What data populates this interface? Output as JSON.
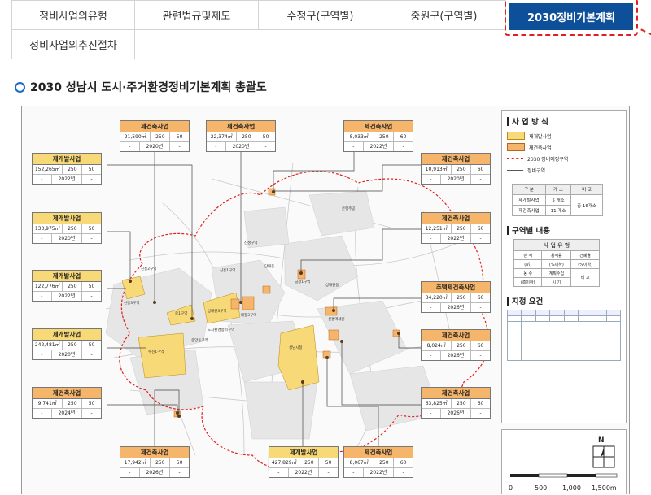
{
  "tabs": [
    {
      "label": "정비사업의유형",
      "active": false
    },
    {
      "label": "관련법규및제도",
      "active": false
    },
    {
      "label": "수정구(구역별)",
      "active": false
    },
    {
      "label": "중원구(구역별)",
      "active": false
    },
    {
      "label": "2030정비기본계획",
      "active": true
    },
    {
      "label": "정비사업의추진절차",
      "active": false
    }
  ],
  "section": {
    "title": "2030 성남시 도시·주거환경정비기본계획 총괄도"
  },
  "colors": {
    "accent": "#0e4f9a",
    "redevelopment": "#f8d978",
    "reconstruction": "#f5b56b",
    "boundary_dash": "#e02020"
  },
  "callouts": [
    {
      "id": "t1",
      "type": "제건축사업",
      "area": "21,590㎡",
      "v1": "250",
      "v2": "50",
      "r2a": "-",
      "year": "2020년",
      "r2c": "-"
    },
    {
      "id": "t2",
      "type": "제건축사업",
      "area": "22,374㎡",
      "v1": "250",
      "v2": "50",
      "r2a": "-",
      "year": "2020년",
      "r2c": "-"
    },
    {
      "id": "t3",
      "type": "제건축사업",
      "area": "8,033㎡",
      "v1": "250",
      "v2": "60",
      "r2a": "-",
      "year": "2022년",
      "r2c": "-"
    },
    {
      "id": "l1",
      "type": "제개발사업",
      "area": "152,265㎡",
      "v1": "250",
      "v2": "50",
      "r2a": "-",
      "year": "2022년",
      "r2c": "-"
    },
    {
      "id": "l2",
      "type": "제개발사업",
      "area": "133,975㎡",
      "v1": "250",
      "v2": "50",
      "r2a": "-",
      "year": "2020년",
      "r2c": "-"
    },
    {
      "id": "l3",
      "type": "제개발사업",
      "area": "122,776㎡",
      "v1": "250",
      "v2": "50",
      "r2a": "-",
      "year": "2022년",
      "r2c": "-"
    },
    {
      "id": "l4",
      "type": "제개발사업",
      "area": "242,481㎡",
      "v1": "250",
      "v2": "50",
      "r2a": "-",
      "year": "2020년",
      "r2c": "-"
    },
    {
      "id": "l5",
      "type": "제건축사업",
      "area": "9,741㎡",
      "v1": "250",
      "v2": "50",
      "r2a": "-",
      "year": "2024년",
      "r2c": "-"
    },
    {
      "id": "r1",
      "type": "제건축사업",
      "area": "10,913㎡",
      "v1": "250",
      "v2": "60",
      "r2a": "-",
      "year": "2020년",
      "r2c": "-"
    },
    {
      "id": "r2",
      "type": "제건축사업",
      "area": "12,251㎡",
      "v1": "250",
      "v2": "60",
      "r2a": "-",
      "year": "2022년",
      "r2c": "-"
    },
    {
      "id": "r3",
      "type": "주택제건축사업",
      "area": "34,220㎡",
      "v1": "250",
      "v2": "60",
      "r2a": "-",
      "year": "2026년",
      "r2c": "-"
    },
    {
      "id": "r4",
      "type": "제건축사업",
      "area": "8,024㎡",
      "v1": "250",
      "v2": "60",
      "r2a": "-",
      "year": "2026년",
      "r2c": "-"
    },
    {
      "id": "r5",
      "type": "제건축사업",
      "area": "63,825㎡",
      "v1": "250",
      "v2": "60",
      "r2a": "-",
      "year": "2026년",
      "r2c": "-"
    },
    {
      "id": "b1",
      "type": "제건축사업",
      "area": "17,942㎡",
      "v1": "250",
      "v2": "50",
      "r2a": "-",
      "year": "2026년",
      "r2c": "-"
    },
    {
      "id": "b2",
      "type": "제개발사업",
      "area": "427,829㎡",
      "v1": "250",
      "v2": "50",
      "r2a": "-",
      "year": "2022년",
      "r2c": "-"
    },
    {
      "id": "b3",
      "type": "제건축사업",
      "area": "8,067㎡",
      "v1": "250",
      "v2": "60",
      "r2a": "-",
      "year": "2022년",
      "r2c": "-"
    }
  ],
  "map_labels": [
    "신흥2구역",
    "신흥3구역",
    "중1구역",
    "상대원3구역",
    "수진1구역",
    "신흥1구역",
    "태평3구역",
    "산성구역",
    "은행주공",
    "금광1구역",
    "중앙동구역",
    "도시환경정비구역",
    "신흥역세권",
    "단대동",
    "상대원동",
    "성남시청"
  ],
  "legend": {
    "method_title": "사 업 방 식",
    "items": [
      {
        "label": "재개발사업",
        "color": "#f8d978"
      },
      {
        "label": "재건축사업",
        "color": "#f5b56b"
      },
      {
        "label": "2030 정비예정구역",
        "style": "dash"
      },
      {
        "label": "정비구역",
        "style": "line"
      }
    ],
    "count_table": {
      "headers": [
        "구 분",
        "개 소",
        "비 고"
      ],
      "rows": [
        [
          "재개발사업",
          "5 개소",
          "총 16개소"
        ],
        [
          "재건축사업",
          "11 개소",
          ""
        ]
      ]
    },
    "zone_title": "구역별 내용",
    "zone_table": {
      "title": "사 업 유 형",
      "rows": [
        [
          "면 적",
          "용적률",
          "건폐율"
        ],
        [
          "(㎡)",
          "(%이하)",
          "(%이하)"
        ],
        [
          "동 수",
          "계획수립",
          "비 고"
        ],
        [
          "(층이하)",
          "시 기",
          ""
        ]
      ]
    },
    "req_title": "지정 요건"
  },
  "scale": {
    "north": "N",
    "ticks": [
      "0",
      "500",
      "1,000",
      "1,500m"
    ]
  }
}
